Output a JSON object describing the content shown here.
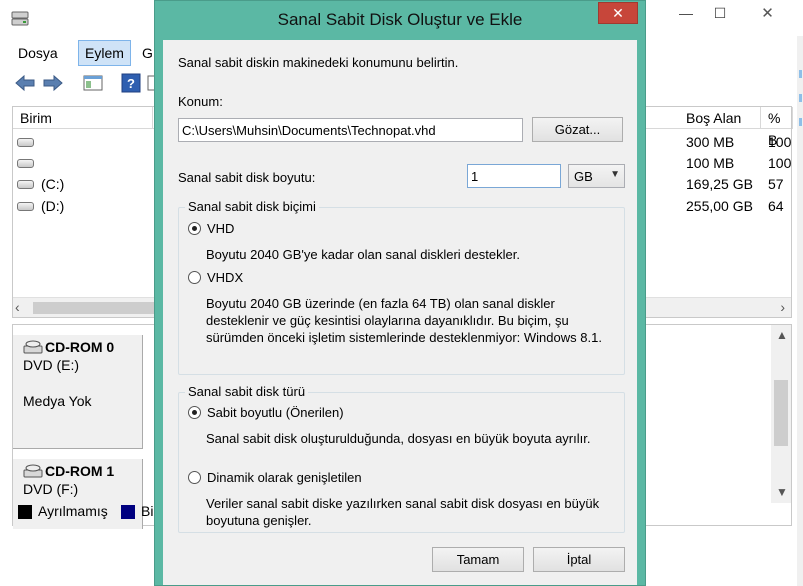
{
  "background_window": {
    "menu": {
      "dosya": "Dosya",
      "eylem": "Eylem",
      "gorunum": "G"
    },
    "list": {
      "headers": {
        "birim": "Birim",
        "bos_alan": "Boş Alan",
        "yuzde": "% B"
      },
      "rows": [
        {
          "name": "",
          "free": "300 MB",
          "pct": "100"
        },
        {
          "name": "",
          "free": "100 MB",
          "pct": "100"
        },
        {
          "name": "(C:)",
          "free": "169,25 GB",
          "pct": "57"
        },
        {
          "name": "(D:)",
          "free": "255,00 GB",
          "pct": "64"
        }
      ]
    },
    "disks": [
      {
        "title": "CD-ROM 0",
        "drive": "DVD (E:)",
        "media": "Medya Yok"
      },
      {
        "title": "CD-ROM 1",
        "drive": "DVD (F:)"
      }
    ],
    "legend": {
      "unallocated": "Ayrılmamış",
      "primary": "Bi"
    }
  },
  "dialog": {
    "title": "Sanal Sabit Disk Oluştur ve Ekle",
    "close_glyph": "✕",
    "instruction": "Sanal sabit diskin makinedeki konumunu belirtin.",
    "location": {
      "label": "Konum:",
      "value": "C:\\Users\\Muhsin\\Documents\\Technopat.vhd",
      "browse_label": "Gözat..."
    },
    "size": {
      "label": "Sanal sabit disk boyutu:",
      "value": "1",
      "unit": "GB"
    },
    "format_group": {
      "title": "Sanal sabit disk biçimi",
      "vhd_label": "VHD",
      "vhd_desc": "Boyutu 2040 GB'ye kadar olan sanal diskleri destekler.",
      "vhdx_label": "VHDX",
      "vhdx_desc": "Boyutu 2040 GB üzerinde (en fazla 64 TB) olan sanal diskler desteklenir ve güç kesintisi olaylarına dayanıklıdır. Bu biçim, şu sürümden önceki işletim sistemlerinde desteklenmiyor: Windows 8.1."
    },
    "type_group": {
      "title": "Sanal sabit disk türü",
      "fixed_label": "Sabit boyutlu (Önerilen)",
      "fixed_desc": "Sanal sabit disk oluşturulduğunda, dosyası en büyük boyuta ayrılır.",
      "dynamic_label": "Dinamik olarak genişletilen",
      "dynamic_desc": "Veriler sanal sabit diske yazılırken sanal sabit disk dosyası en büyük boyutuna genişler."
    },
    "ok_label": "Tamam",
    "cancel_label": "İptal"
  },
  "colors": {
    "dialog_frame": "#5bb8a4",
    "close_button": "#c7463a",
    "menu_highlight": "#cfe3f7"
  }
}
